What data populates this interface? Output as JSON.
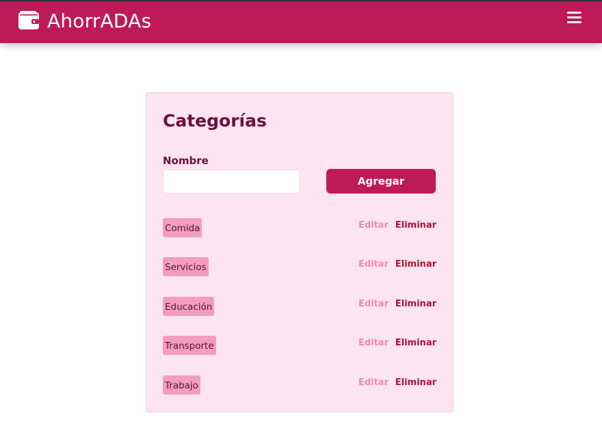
{
  "header": {
    "brand": "AhorrADAs",
    "brand_icon": "wallet-icon",
    "menu_icon": "hamburger-menu-icon",
    "color": "#bf1a58"
  },
  "categories_panel": {
    "title": "Categorías",
    "name_label": "Nombre",
    "name_value": "",
    "name_placeholder": "",
    "add_label": "Agregar",
    "items": [
      {
        "name": "Comida",
        "edit": "Editar",
        "delete": "Eliminar"
      },
      {
        "name": "Servicios",
        "edit": "Editar",
        "delete": "Eliminar"
      },
      {
        "name": "Educación",
        "edit": "Editar",
        "delete": "Eliminar"
      },
      {
        "name": "Transporte",
        "edit": "Editar",
        "delete": "Eliminar"
      },
      {
        "name": "Trabajo",
        "edit": "Editar",
        "delete": "Eliminar"
      }
    ],
    "colors": {
      "panel_bg": "#fce4f1",
      "tag_bg": "#f29dbf",
      "edit": "#f08ab2",
      "delete": "#b01236"
    }
  }
}
